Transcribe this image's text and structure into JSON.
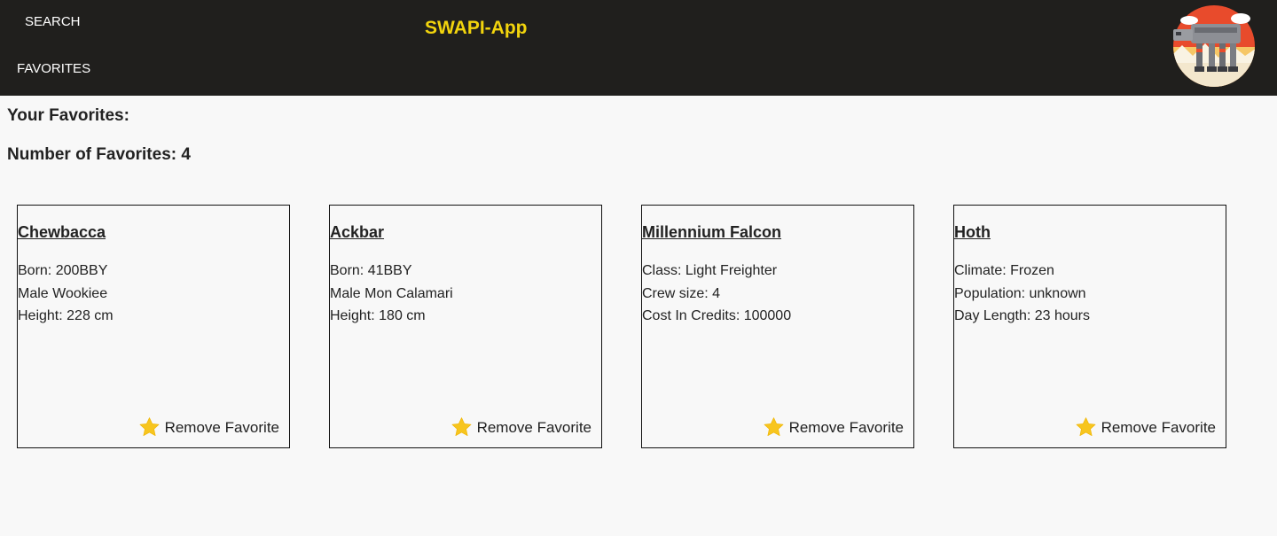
{
  "header": {
    "nav_search": "SEARCH",
    "nav_favorites": "FAVORITES",
    "app_title": "SWAPI-App",
    "logo_icon": "at-at-walker-logo"
  },
  "main": {
    "heading": "Your Favorites:",
    "count_text": "Number of Favorites: 4"
  },
  "cards": [
    {
      "title": "Chewbacca",
      "lines": [
        "Born: 200BBY",
        "Male Wookiee",
        "Height: 228 cm"
      ],
      "remove_label": "Remove Favorite"
    },
    {
      "title": "Ackbar",
      "lines": [
        "Born: 41BBY",
        "Male Mon Calamari",
        "Height: 180 cm"
      ],
      "remove_label": "Remove Favorite"
    },
    {
      "title": "Millennium Falcon",
      "lines": [
        "Class: Light Freighter",
        "Crew size: 4",
        "Cost In Credits: 100000"
      ],
      "remove_label": "Remove Favorite"
    },
    {
      "title": "Hoth",
      "lines": [
        "Climate: Frozen",
        "Population: unknown",
        "Day Length: 23 hours"
      ],
      "remove_label": "Remove Favorite"
    }
  ],
  "colors": {
    "header_bg": "#201f1d",
    "title_accent": "#f2d40d",
    "star": "#f7c51e"
  },
  "icons": {
    "star": "star-icon"
  }
}
